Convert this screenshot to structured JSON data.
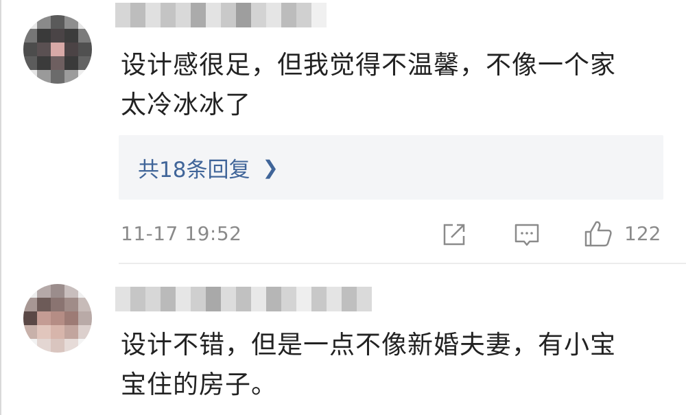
{
  "comments": [
    {
      "text_line1": "设计感很足，但我觉得不温馨，不像一个家",
      "text_line2": "太冷冰冰了",
      "replies_label": "共18条回复",
      "timestamp": "11-17 19:52",
      "like_count": "122"
    },
    {
      "text_line1": "设计不错，但是一点不像新婚夫妻，有小宝",
      "text_line2": "宝住的房子。"
    }
  ],
  "icons": {
    "share": "share-icon",
    "comment": "comment-icon",
    "like": "thumbs-up-icon",
    "chevron": "chevron-right-icon"
  },
  "colors": {
    "reply_link": "#406599",
    "meta_text": "#8a8a8a",
    "body_text": "#222222",
    "reply_bg": "#f4f5f7"
  }
}
